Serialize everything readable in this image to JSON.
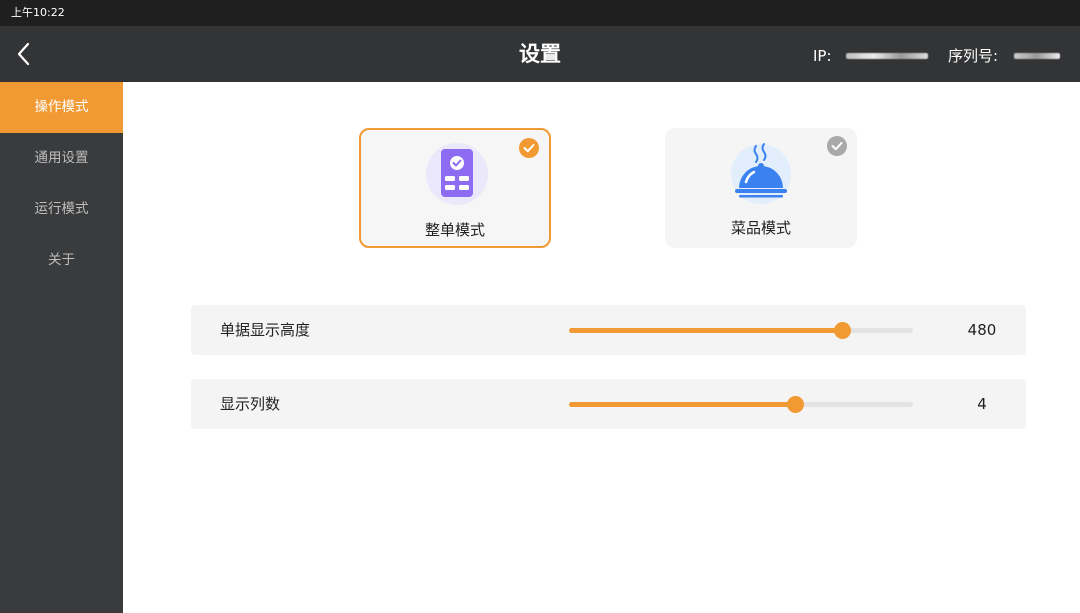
{
  "status_bar": {
    "time": "上午10:22"
  },
  "header": {
    "title": "设置",
    "ip_label": "IP:",
    "serial_label": "序列号:"
  },
  "sidebar": {
    "items": [
      {
        "label": "操作模式",
        "active": true
      },
      {
        "label": "通用设置",
        "active": false
      },
      {
        "label": "运行模式",
        "active": false
      },
      {
        "label": "关于",
        "active": false
      }
    ]
  },
  "modes": [
    {
      "label": "整单模式",
      "selected": true,
      "icon": "order-document-icon"
    },
    {
      "label": "菜品模式",
      "selected": false,
      "icon": "food-cloche-icon"
    }
  ],
  "settings": [
    {
      "label": "单据显示高度",
      "value": "480",
      "fraction": 0.795
    },
    {
      "label": "显示列数",
      "value": "4",
      "fraction": 0.657
    }
  ],
  "colors": {
    "accent": "#f19a34",
    "header_bg": "#333436",
    "sidebar_bg": "#3a3b3d",
    "icon_purple": "#8d6cf2",
    "icon_blue": "#3b82f0"
  }
}
